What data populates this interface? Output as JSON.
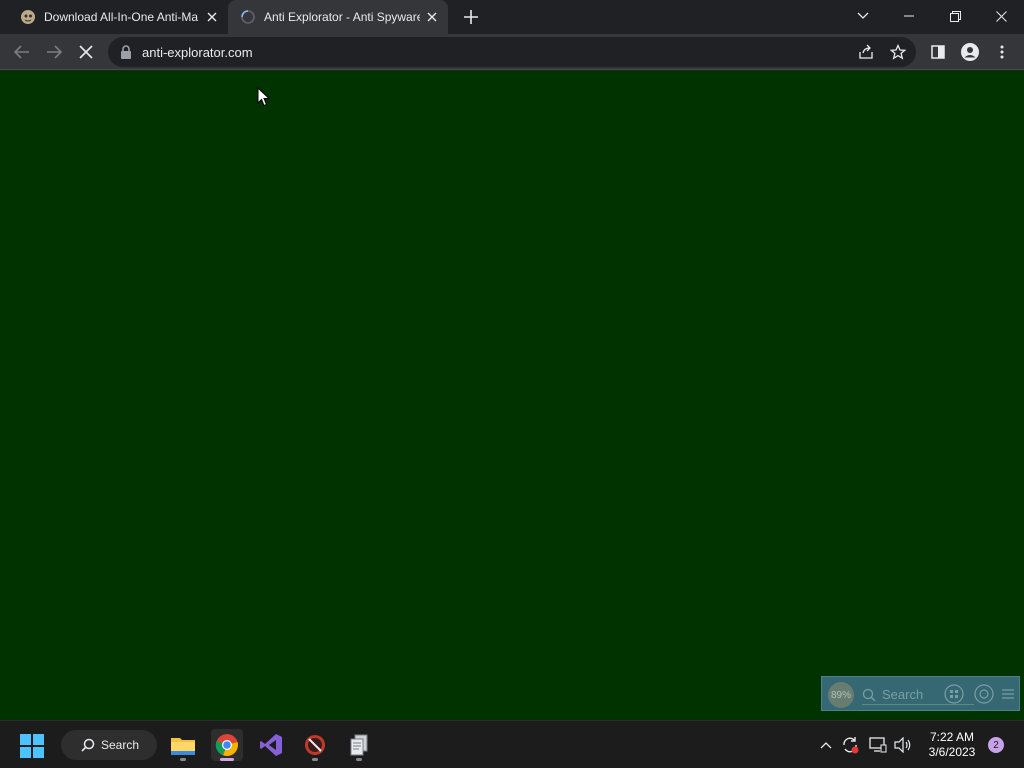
{
  "browser": {
    "tabs": [
      {
        "title": "Download All-In-One Anti-Ma",
        "icon": "favicon-mascot-icon",
        "active": false
      },
      {
        "title": "Anti Explorator - Anti Spyware",
        "icon": "loading-spinner-icon",
        "active": true
      }
    ],
    "address_bar": {
      "url": "anti-explorator.com",
      "secure": true
    },
    "page_state": "loading"
  },
  "page": {
    "background_color": "#003300"
  },
  "overlay_widget": {
    "percent": "89%",
    "search_placeholder": "Search"
  },
  "taskbar": {
    "search_label": "Search",
    "apps": [
      {
        "name": "File Explorer",
        "icon": "folder-icon",
        "active": false
      },
      {
        "name": "Google Chrome",
        "icon": "chrome-icon",
        "active": true
      },
      {
        "name": "Visual Studio",
        "icon": "visual-studio-icon",
        "active": false
      },
      {
        "name": "App",
        "icon": "blocked-app-icon",
        "active": false
      },
      {
        "name": "App",
        "icon": "documents-icon",
        "active": false
      }
    ],
    "clock": {
      "time": "7:22 AM",
      "date": "3/6/2023"
    },
    "notification_count": "2"
  },
  "colors": {
    "tab_strip": "#202124",
    "toolbar": "#35363a",
    "page_bg": "#003300",
    "taskbar": "#1c1c1c",
    "accent": "#c7a2e8"
  }
}
